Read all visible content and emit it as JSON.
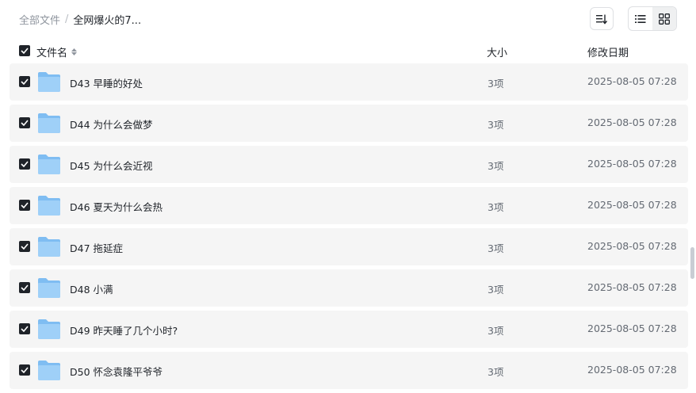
{
  "breadcrumb": {
    "root": "全部文件",
    "separator": "/",
    "current": "全网爆火的7..."
  },
  "header": {
    "name": "文件名",
    "size": "大小",
    "date": "修改日期"
  },
  "toolbar": {
    "sort_icon": "sort-icon",
    "list_view_icon": "list-view-icon",
    "grid_view_icon": "grid-view-icon"
  },
  "colors": {
    "row_bg": "#f5f5f5",
    "checkbox": "#1f2329",
    "folder_blue": "#8cc7f5"
  },
  "rows": [
    {
      "name": "D43 早睡的好处",
      "size": "3项",
      "date": "2025-08-05 07:28"
    },
    {
      "name": "D44 为什么会做梦",
      "size": "3项",
      "date": "2025-08-05 07:28"
    },
    {
      "name": "D45 为什么会近视",
      "size": "3项",
      "date": "2025-08-05 07:28"
    },
    {
      "name": "D46 夏天为什么会热",
      "size": "3项",
      "date": "2025-08-05 07:28"
    },
    {
      "name": "D47 拖延症",
      "size": "3项",
      "date": "2025-08-05 07:28"
    },
    {
      "name": "D48 小满",
      "size": "3项",
      "date": "2025-08-05 07:28"
    },
    {
      "name": "D49 昨天睡了几个小时?",
      "size": "3项",
      "date": "2025-08-05 07:28"
    },
    {
      "name": "D50 怀念袁隆平爷爷",
      "size": "3项",
      "date": "2025-08-05 07:28"
    }
  ]
}
